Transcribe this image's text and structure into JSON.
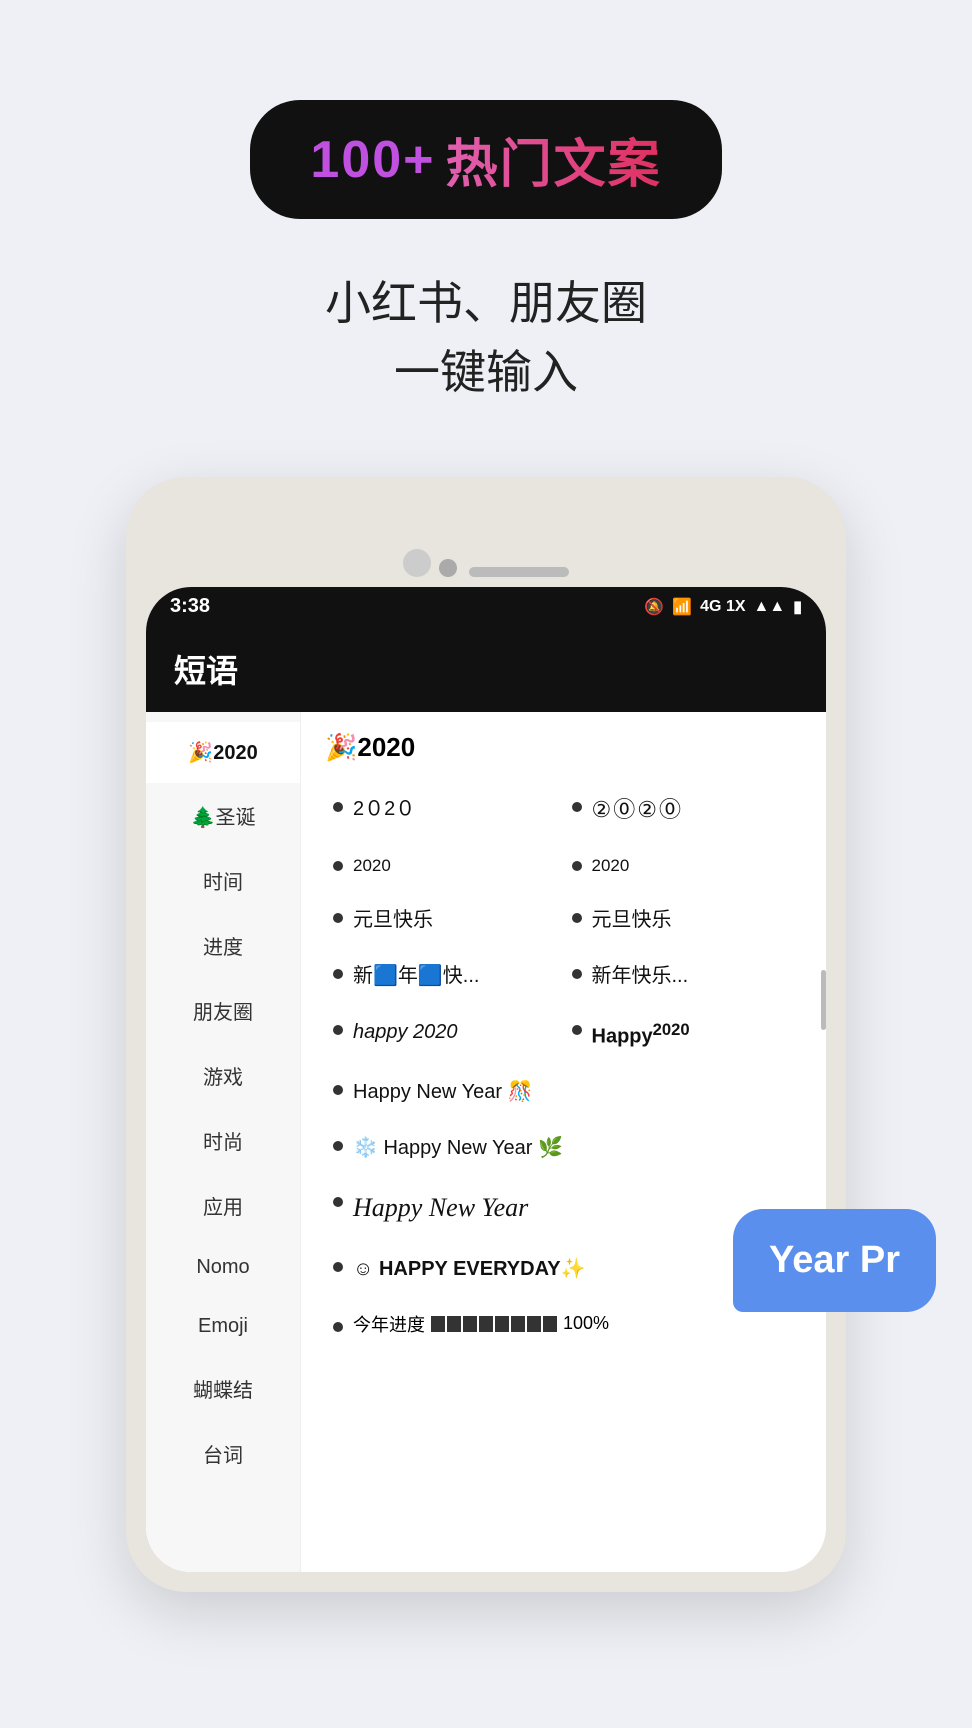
{
  "hero": {
    "badge": {
      "text1": "100+ ",
      "text2": "热门文案"
    },
    "subtitle_line1": "小红书、朋友圈",
    "subtitle_line2": "一键输入"
  },
  "phone": {
    "time": "3:38",
    "app_title": "短语",
    "sidebar_items": [
      {
        "label": "🎉2020",
        "active": true
      },
      {
        "label": "🌲圣诞",
        "active": false
      },
      {
        "label": "时间",
        "active": false
      },
      {
        "label": "进度",
        "active": false
      },
      {
        "label": "朋友圈",
        "active": false
      },
      {
        "label": "游戏",
        "active": false
      },
      {
        "label": "时尚",
        "active": false
      },
      {
        "label": "应用",
        "active": false
      },
      {
        "label": "Nomo",
        "active": false
      },
      {
        "label": "Emoji",
        "active": false
      },
      {
        "label": "蝴蝶结",
        "active": false
      },
      {
        "label": "台词",
        "active": false
      }
    ],
    "section_title": "🎉2020",
    "items": [
      {
        "text": "2０2０",
        "style": "normal",
        "col": "left"
      },
      {
        "text": "②⓪②⓪",
        "style": "circled",
        "col": "right"
      },
      {
        "text": "2020",
        "style": "small",
        "col": "left"
      },
      {
        "text": "2020",
        "style": "small2",
        "col": "right"
      },
      {
        "text": "元旦快乐",
        "style": "normal",
        "col": "left"
      },
      {
        "text": "元旦快乐",
        "style": "normal",
        "col": "right"
      },
      {
        "text": "新🟦年🟦快...",
        "style": "normal",
        "col": "left"
      },
      {
        "text": "新年快乐...",
        "style": "normal",
        "col": "right"
      },
      {
        "text": "happy 2020",
        "style": "italic",
        "col": "left"
      },
      {
        "text": "Happy²⁰²⁰",
        "style": "bold",
        "col": "right"
      },
      {
        "text": "Happy New Year 🎊",
        "style": "normal",
        "col": "single"
      },
      {
        "text": "❄️ Happy New Year 🌿",
        "style": "normal",
        "col": "single"
      },
      {
        "text": "Happy New Year",
        "style": "decorative",
        "col": "single"
      },
      {
        "text": "☺ HAPPY EVERYDAY✨",
        "style": "normal",
        "col": "single"
      },
      {
        "text": "今年进度",
        "progress_blocks": 8,
        "percent": "100%",
        "style": "progress"
      }
    ],
    "blue_bubble_text": "Year Pr"
  }
}
